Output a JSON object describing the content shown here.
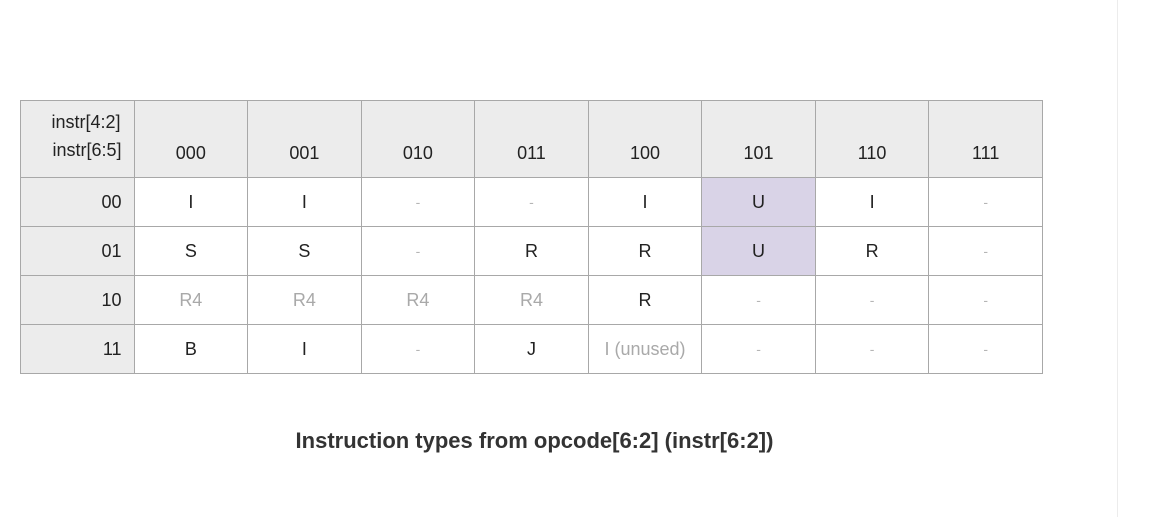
{
  "table": {
    "corner_top": "instr[4:2]",
    "corner_bottom": "instr[6:5]",
    "columns": [
      "000",
      "001",
      "010",
      "011",
      "100",
      "101",
      "110",
      "111"
    ],
    "rows": [
      {
        "label": "00",
        "cells": [
          {
            "text": "I",
            "style": "normal"
          },
          {
            "text": "I",
            "style": "normal"
          },
          {
            "text": "-",
            "style": "dash"
          },
          {
            "text": "-",
            "style": "dash"
          },
          {
            "text": "I",
            "style": "normal"
          },
          {
            "text": "U",
            "style": "highlight"
          },
          {
            "text": "I",
            "style": "normal"
          },
          {
            "text": "-",
            "style": "dash"
          }
        ]
      },
      {
        "label": "01",
        "cells": [
          {
            "text": "S",
            "style": "normal"
          },
          {
            "text": "S",
            "style": "normal"
          },
          {
            "text": "-",
            "style": "dash"
          },
          {
            "text": "R",
            "style": "normal"
          },
          {
            "text": "R",
            "style": "normal"
          },
          {
            "text": "U",
            "style": "highlight"
          },
          {
            "text": "R",
            "style": "normal"
          },
          {
            "text": "-",
            "style": "dash"
          }
        ]
      },
      {
        "label": "10",
        "cells": [
          {
            "text": "R4",
            "style": "muted"
          },
          {
            "text": "R4",
            "style": "muted"
          },
          {
            "text": "R4",
            "style": "muted"
          },
          {
            "text": "R4",
            "style": "muted"
          },
          {
            "text": "R",
            "style": "normal"
          },
          {
            "text": "-",
            "style": "dash"
          },
          {
            "text": "-",
            "style": "dash"
          },
          {
            "text": "-",
            "style": "dash"
          }
        ]
      },
      {
        "label": "11",
        "cells": [
          {
            "text": "B",
            "style": "normal"
          },
          {
            "text": "I",
            "style": "normal"
          },
          {
            "text": "-",
            "style": "dash"
          },
          {
            "text": "J",
            "style": "normal"
          },
          {
            "text": "I (unused)",
            "style": "muted"
          },
          {
            "text": "-",
            "style": "dash"
          },
          {
            "text": "-",
            "style": "dash"
          },
          {
            "text": "-",
            "style": "dash"
          }
        ]
      }
    ],
    "colors": {
      "header_bg": "#ececec",
      "highlight_bg": "#d9d3e7",
      "border": "#a8a8a8",
      "muted_text": "#a9a9a9"
    }
  },
  "caption": "Instruction types from opcode[6:2] (instr[6:2])"
}
